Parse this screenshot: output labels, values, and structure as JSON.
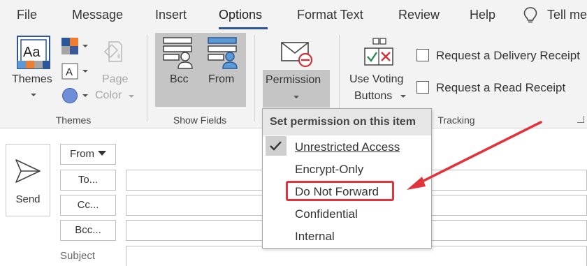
{
  "tabs": [
    "File",
    "Message",
    "Insert",
    "Options",
    "Format Text",
    "Review",
    "Help",
    "Tell me"
  ],
  "active_tab": "Options",
  "ribbon": {
    "themes_group": {
      "themes_label": "Themes",
      "font_glyph": "A",
      "page_color_label": "Page\nColor",
      "page_color_line1": "Page",
      "page_color_line2": "Color",
      "group_label": "Themes"
    },
    "show_fields_group": {
      "bcc_label": "Bcc",
      "from_label": "From",
      "group_label": "Show Fields"
    },
    "permission_label": "Permission",
    "tracking_group": {
      "voting_line1": "Use Voting",
      "voting_line2": "Buttons",
      "delivery_receipt_label": "Request a Delivery Receipt",
      "read_receipt_label": "Request a Read Receipt",
      "group_label": "Tracking"
    }
  },
  "compose": {
    "send_label": "Send",
    "from_label": "From",
    "to_label": "To...",
    "cc_label": "Cc...",
    "bcc_label": "Bcc...",
    "subject_label": "Subject"
  },
  "permission_menu": {
    "header": "Set permission on this item",
    "items": [
      {
        "label": "Unrestricted Access",
        "checked": true
      },
      {
        "label": "Encrypt-Only",
        "checked": false
      },
      {
        "label": "Do Not Forward",
        "checked": false
      },
      {
        "label": "Confidential",
        "checked": false
      },
      {
        "label": "Internal",
        "checked": false
      }
    ],
    "highlighted_item": "Do Not Forward"
  },
  "colors": {
    "accent_blue": "#2b579a",
    "annotation_red": "#e2333b",
    "ribbon_bg": "#f3f3f3",
    "selected_bg": "#c5c5c5"
  },
  "icons": [
    "lightbulb-icon",
    "themes-icon",
    "theme-colors-icon",
    "theme-fonts-icon",
    "theme-effects-icon",
    "page-color-icon",
    "bcc-field-icon",
    "from-field-icon",
    "permission-envelope-icon",
    "voting-buttons-icon",
    "send-icon",
    "check-icon"
  ]
}
